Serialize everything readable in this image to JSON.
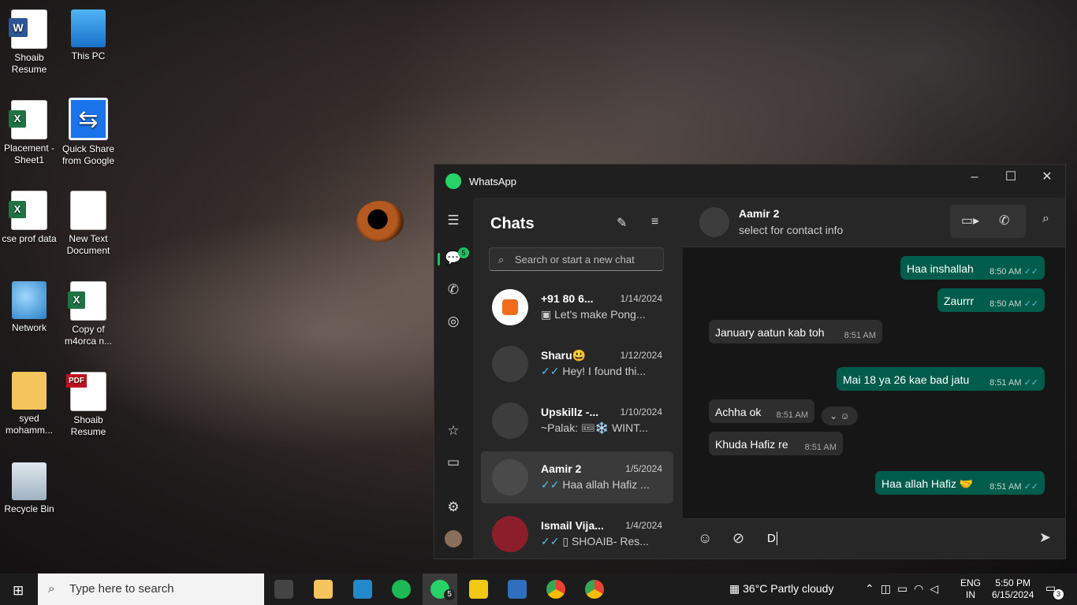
{
  "desktop": {
    "icons": [
      {
        "label": "Shoaib Resume",
        "icon": "word-icon"
      },
      {
        "label": "This PC",
        "icon": "pc-icon"
      },
      {
        "label": "Placement - Sheet1",
        "icon": "excel-icon"
      },
      {
        "label": "Quick Share from Google",
        "icon": "quick-share-icon"
      },
      {
        "label": "cse prof data",
        "icon": "excel-icon"
      },
      {
        "label": "New Text Document",
        "icon": "text-document-icon"
      },
      {
        "label": "Network",
        "icon": "network-icon"
      },
      {
        "label": "Copy of m4orca n...",
        "icon": "excel-icon"
      },
      {
        "label": "syed mohamm...",
        "icon": "user-folder-icon"
      },
      {
        "label": "Shoaib Resume",
        "icon": "pdf-icon"
      },
      {
        "label": "Recycle Bin",
        "icon": "recycle-bin-icon"
      }
    ]
  },
  "whatsapp": {
    "title": "WhatsApp",
    "unread_badge": "5",
    "chats_heading": "Chats",
    "search_placeholder": "Search or start a new chat",
    "chats": [
      {
        "name": "+91 80 6...",
        "date": "1/14/2024",
        "preview": "Let's make Pong..."
      },
      {
        "name": "Sharu😃",
        "date": "1/12/2024",
        "preview": "Hey!  I found thi..."
      },
      {
        "name": "Upskillz -...",
        "date": "1/10/2024",
        "preview": "~Palak: 🎟❄️ WINT..."
      },
      {
        "name": "Aamir 2",
        "date": "1/5/2024",
        "preview": "Haa allah Hafiz ..."
      },
      {
        "name": "Ismail Vija...",
        "date": "1/4/2024",
        "preview": "SHOAIB- Res..."
      }
    ],
    "contact": {
      "name": "Aamir 2",
      "subtitle": "select for contact info"
    },
    "messages": [
      {
        "text": "Haa inshallah",
        "time": "8:50 AM",
        "dir": "out"
      },
      {
        "text": "Zaurrr",
        "time": "8:50 AM",
        "dir": "out"
      },
      {
        "text": "January aatun kab toh",
        "time": "8:51 AM",
        "dir": "in"
      },
      {
        "text": "Mai 18 ya 26 kae bad jatu",
        "time": "8:51 AM",
        "dir": "out"
      },
      {
        "text": "Achha ok",
        "time": "8:51 AM",
        "dir": "in"
      },
      {
        "text": "Khuda Hafiz re",
        "time": "8:51 AM",
        "dir": "in"
      },
      {
        "text": "Haa allah Hafiz 🤝",
        "time": "8:51 AM",
        "dir": "out"
      }
    ],
    "composer_value": "D",
    "accent": "#21c063"
  },
  "taskbar": {
    "search_placeholder": "Type here to search",
    "weather": "36°C  Partly cloudy",
    "lang": "ENG",
    "region": "IN",
    "time": "5:50 PM",
    "date": "6/15/2024",
    "whatsapp_badge": "5",
    "notification_count": "3"
  }
}
